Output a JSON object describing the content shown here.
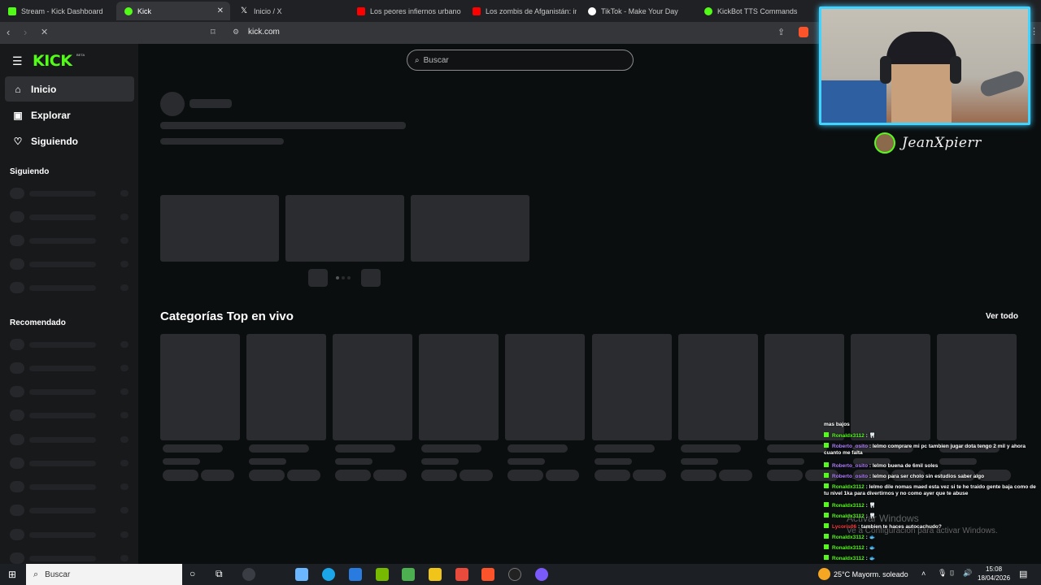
{
  "browser": {
    "tabs": [
      {
        "title": "Stream - Kick Dashboard",
        "color": "#53fc18"
      },
      {
        "title": "Kick",
        "color": "#53fc18"
      },
      {
        "title": "Inicio / X",
        "color": "#ffffff"
      },
      {
        "title": "Los peores infiernos urbanos d",
        "color": "#ff0000"
      },
      {
        "title": "Los zombis de Afganistán: inclu",
        "color": "#ff0000"
      },
      {
        "title": "TikTok - Make Your Day",
        "color": "#ffffff"
      },
      {
        "title": "KickBot TTS Commands",
        "color": "#53fc18"
      }
    ],
    "url": "kick.com"
  },
  "kick": {
    "logo": "KICK",
    "logo_badge": "BETA",
    "search_placeholder": "Buscar",
    "nav": [
      {
        "label": "Inicio",
        "icon": "home-icon"
      },
      {
        "label": "Explorar",
        "icon": "explore-icon"
      },
      {
        "label": "Siguiendo",
        "icon": "heart-icon"
      }
    ],
    "following_heading": "Siguiendo",
    "recommended_heading": "Recomendado",
    "top_categories_title": "Categorías Top en vivo",
    "see_all": "Ver todo"
  },
  "overlay": {
    "streamer_name": "JeanXpierr",
    "chat": [
      {
        "user": "",
        "text": "mas bajos",
        "kind": "plain"
      },
      {
        "user": "Ronaldx3112",
        "text": ": 🦷",
        "kind": "green"
      },
      {
        "user": "Roberto_osito",
        "text": ": lelmo comprare mi pc tambien jugar dota tengo 2 mil y ahora cuanto me falta",
        "kind": "purple"
      },
      {
        "user": "Roberto_osito",
        "text": ": lelmo buena de 6mil soles",
        "kind": "purple"
      },
      {
        "user": "Roberto_osito",
        "text": ": lelmo para ser cholo sin estudios saber algo",
        "kind": "purple"
      },
      {
        "user": "Ronaldx3112",
        "text": ": lelmo dile nomas maed esta vez si te he traido gente baja como de tu nivel 1ka para divertirnos y no como ayer que te abuse",
        "kind": "green"
      },
      {
        "user": "Ronaldx3112",
        "text": ": 🦷",
        "kind": "green"
      },
      {
        "user": "Ronaldx3112",
        "text": ": 🦷",
        "kind": "green"
      },
      {
        "user": "Lycoris06",
        "text": ": tambien te haces autocachudo?",
        "kind": "red"
      },
      {
        "user": "Ronaldx3112",
        "text": ": 🐟",
        "kind": "green"
      },
      {
        "user": "Ronaldx3112",
        "text": ": 🐟",
        "kind": "green"
      },
      {
        "user": "Ronaldx3112",
        "text": ": 🐟",
        "kind": "green"
      },
      {
        "user": "Ronaldx3112",
        "text": ": 🐟",
        "kind": "green"
      },
      {
        "user": "Ronaldx3112",
        "text": ": 🐟",
        "kind": "green"
      }
    ],
    "watermark_title": "Activar Windows",
    "watermark_sub": "Ve a Configuración para activar Windows."
  },
  "taskbar": {
    "search_placeholder": "Buscar",
    "weather": "25°C  Mayorm. soleado",
    "time": "15:08",
    "date": "18/04/2026"
  }
}
